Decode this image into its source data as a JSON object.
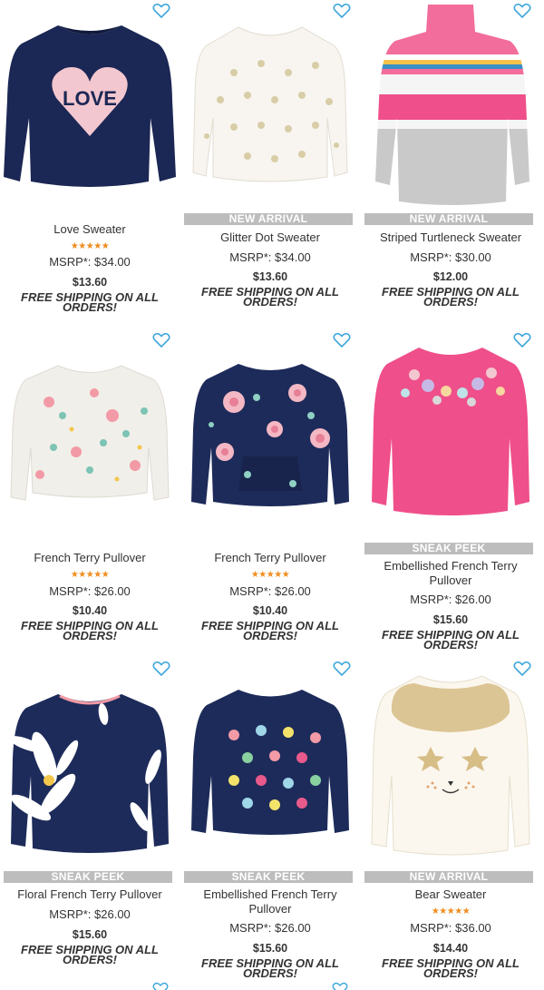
{
  "colors": {
    "accent": "#3ea6dc",
    "badge": "#bdbdbd",
    "stars": "#f08c1d"
  },
  "products": [
    {
      "name": "Love Sweater",
      "badge": "",
      "rating_stars": "★★★★★",
      "rating": 5,
      "msrp": "MSRP*: $34.00",
      "price": "$13.60",
      "shipping": "FREE SHIPPING ON ALL ORDERS!",
      "image": "navy-love-sweater",
      "favorite_icon": "heart-outline-icon"
    },
    {
      "name": "Glitter Dot Sweater",
      "badge": "NEW ARRIVAL",
      "rating_stars": "",
      "rating": null,
      "msrp": "MSRP*: $34.00",
      "price": "$13.60",
      "shipping": "FREE SHIPPING ON ALL ORDERS!",
      "image": "white-glitter-dot-sweater",
      "favorite_icon": "heart-outline-icon"
    },
    {
      "name": "Striped Turtleneck Sweater",
      "badge": "NEW ARRIVAL",
      "rating_stars": "",
      "rating": null,
      "msrp": "MSRP*: $30.00",
      "price": "$12.00",
      "shipping": "FREE SHIPPING ON ALL ORDERS!",
      "image": "striped-turtleneck-sweater",
      "favorite_icon": "heart-outline-icon"
    },
    {
      "name": "French Terry Pullover",
      "badge": "",
      "rating_stars": "★★★★★",
      "rating": 5,
      "msrp": "MSRP*: $26.00",
      "price": "$10.40",
      "shipping": "FREE SHIPPING ON ALL ORDERS!",
      "image": "white-floral-pullover",
      "favorite_icon": "heart-outline-icon"
    },
    {
      "name": "French Terry Pullover",
      "badge": "",
      "rating_stars": "★★★★★",
      "rating": 5,
      "msrp": "MSRP*: $26.00",
      "price": "$10.40",
      "shipping": "FREE SHIPPING ON ALL ORDERS!",
      "image": "navy-floral-pullover",
      "favorite_icon": "heart-outline-icon"
    },
    {
      "name": "Embellished French Terry Pullover",
      "badge": "SNEAK PEEK",
      "rating_stars": "",
      "rating": null,
      "msrp": "MSRP*: $26.00",
      "price": "$15.60",
      "shipping": "FREE SHIPPING ON ALL ORDERS!",
      "image": "pink-embellished-pullover",
      "favorite_icon": "heart-outline-icon"
    },
    {
      "name": "Floral French Terry Pullover",
      "badge": "SNEAK PEEK",
      "rating_stars": "",
      "rating": null,
      "msrp": "MSRP*: $26.00",
      "price": "$15.60",
      "shipping": "FREE SHIPPING ON ALL ORDERS!",
      "image": "navy-daisy-pullover",
      "favorite_icon": "heart-outline-icon"
    },
    {
      "name": "Embellished French Terry Pullover",
      "badge": "SNEAK PEEK",
      "rating_stars": "",
      "rating": null,
      "msrp": "MSRP*: $26.00",
      "price": "$15.60",
      "shipping": "FREE SHIPPING ON ALL ORDERS!",
      "image": "navy-pompom-pullover",
      "favorite_icon": "heart-outline-icon"
    },
    {
      "name": "Bear Sweater",
      "badge": "NEW ARRIVAL",
      "rating_stars": "★★★★★",
      "rating": 5,
      "msrp": "MSRP*: $36.00",
      "price": "$14.40",
      "shipping": "FREE SHIPPING ON ALL ORDERS!",
      "image": "white-bear-sweater",
      "favorite_icon": "heart-outline-icon"
    }
  ]
}
